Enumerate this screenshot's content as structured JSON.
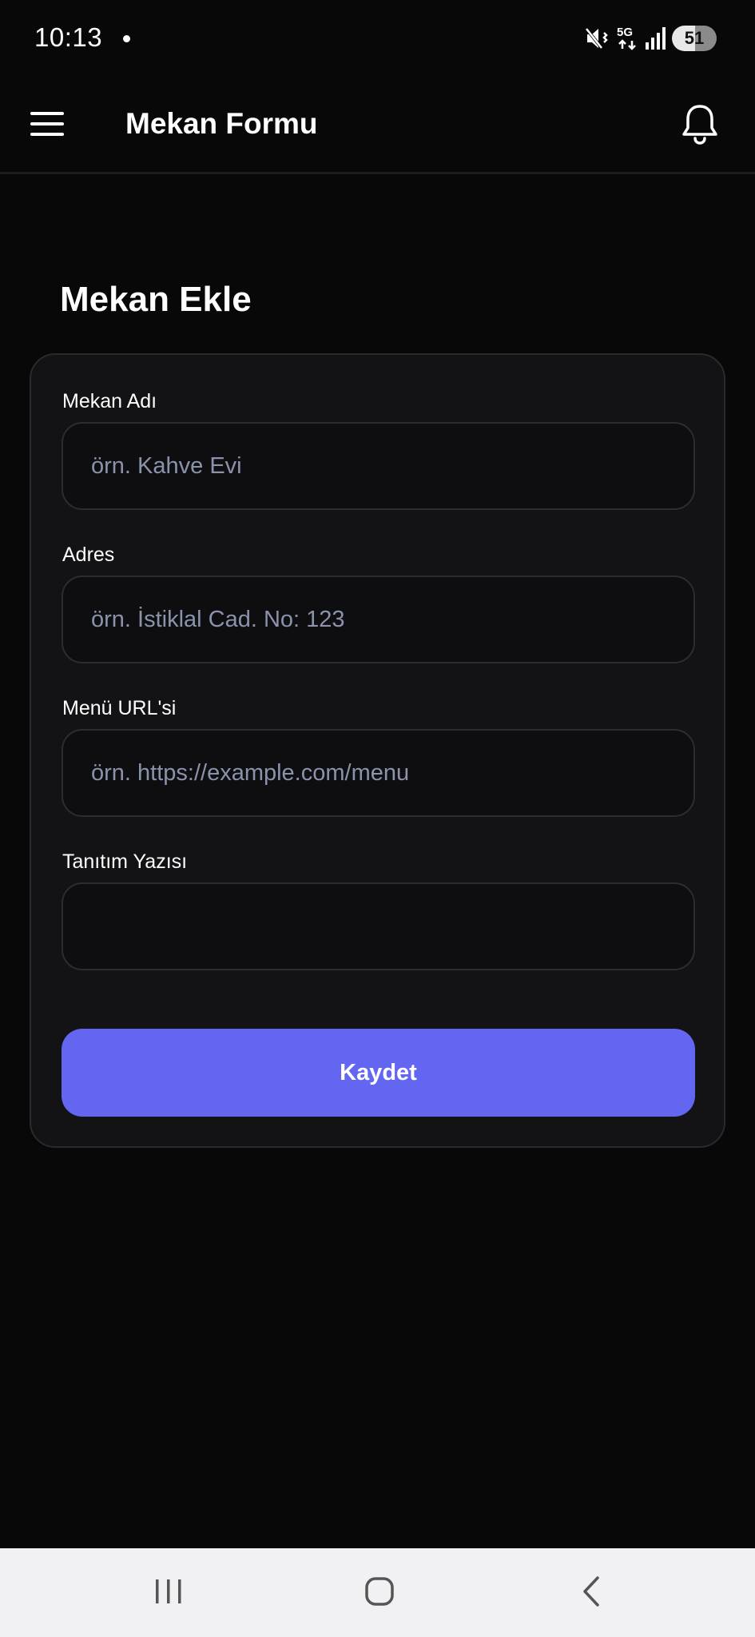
{
  "status_bar": {
    "time": "10:13",
    "battery": "51",
    "icons": [
      "mute-vibrate-icon",
      "5g-icon",
      "signal-icon",
      "battery-icon"
    ]
  },
  "app_bar": {
    "title": "Mekan Formu",
    "menu_icon": "hamburger-menu-icon",
    "notification_icon": "bell-icon"
  },
  "page": {
    "heading": "Mekan Ekle"
  },
  "form": {
    "fields": [
      {
        "label": "Mekan Adı",
        "placeholder": "örn. Kahve Evi",
        "value": ""
      },
      {
        "label": "Adres",
        "placeholder": "örn. İstiklal Cad. No: 123",
        "value": ""
      },
      {
        "label": "Menü URL'si",
        "placeholder": "örn. https://example.com/menu",
        "value": ""
      },
      {
        "label": "Tanıtım Yazısı",
        "placeholder": "",
        "value": ""
      }
    ],
    "submit_label": "Kaydet"
  },
  "nav_bar": {
    "buttons": [
      "recents-icon",
      "home-icon",
      "back-icon"
    ]
  },
  "colors": {
    "background": "#080809",
    "card": "#131316",
    "accent": "#6366f1",
    "placeholder": "#8a93ab"
  }
}
